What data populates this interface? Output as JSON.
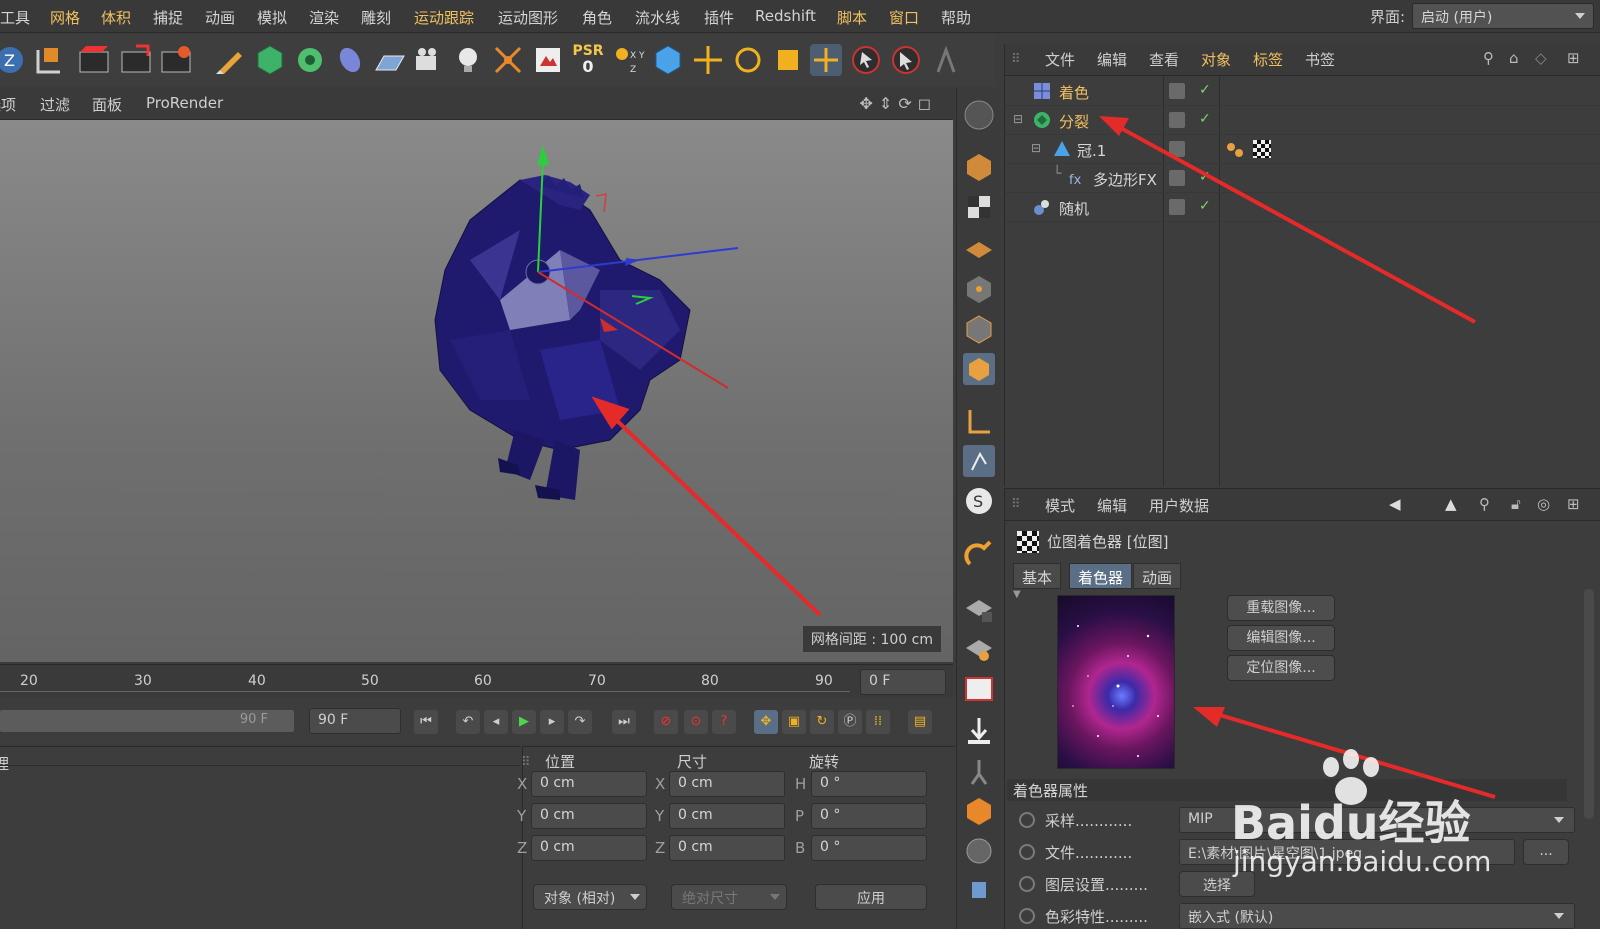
{
  "menubar": {
    "items": [
      "工具",
      "网格",
      "体积",
      "捕捉",
      "动画",
      "模拟",
      "渲染",
      "雕刻",
      "运动跟踪",
      "运动图形",
      "角色",
      "流水线",
      "插件",
      "Redshift",
      "脚本",
      "窗口",
      "帮助"
    ],
    "interface_label": "界面:",
    "interface_value": "启动 (用户)"
  },
  "toolbar": {
    "psr_label": "PSR",
    "psr_value": "0"
  },
  "viewport_menu": {
    "items": [
      "选项",
      "过滤",
      "面板",
      "ProRender"
    ]
  },
  "viewport": {
    "grid_spacing": "网格间距 : 100 cm"
  },
  "object_manager": {
    "menu": [
      "文件",
      "编辑",
      "查看",
      "对象",
      "标签",
      "书签"
    ],
    "rows": [
      {
        "name": "着色"
      },
      {
        "name": "分裂"
      },
      {
        "name": "冠.1"
      },
      {
        "name": "多边形FX"
      },
      {
        "name": "随机"
      }
    ]
  },
  "attribute_manager": {
    "menu": [
      "模式",
      "编辑",
      "用户数据"
    ],
    "title": "位图着色器 [位图]",
    "tabs": [
      "基本",
      "着色器",
      "动画"
    ],
    "active_tab": "着色器",
    "buttons": [
      "重载图像...",
      "编辑图像...",
      "定位图像..."
    ],
    "section": "着色器属性",
    "props": [
      {
        "label": "采样............",
        "value": "MIP"
      },
      {
        "label": "文件............",
        "value": "E:\\素材\\图片\\星空图\\1.jpeg"
      },
      {
        "label": "图层设置.........",
        "value": "选择"
      },
      {
        "label": "色彩特性.........",
        "value": "嵌入式 (默认)"
      }
    ],
    "more_button": "..."
  },
  "timeline": {
    "ticks": [
      "20",
      "30",
      "40",
      "50",
      "60",
      "70",
      "80",
      "90"
    ],
    "current": "0 F",
    "range_end_label": "90 F",
    "end_field": "90 F"
  },
  "coords": {
    "headers": [
      "位置",
      "尺寸",
      "旋转"
    ],
    "pos": [
      {
        "axis": "X",
        "value": "0 cm"
      },
      {
        "axis": "Y",
        "value": "0 cm"
      },
      {
        "axis": "Z",
        "value": "0 cm"
      }
    ],
    "size": [
      {
        "axis": "X",
        "value": "0 cm"
      },
      {
        "axis": "Y",
        "value": "0 cm"
      },
      {
        "axis": "Z",
        "value": "0 cm"
      }
    ],
    "rot": [
      {
        "axis": "H",
        "value": "0 °"
      },
      {
        "axis": "P",
        "value": "0 °"
      },
      {
        "axis": "B",
        "value": "0 °"
      }
    ],
    "mode_select": "对象 (相对)",
    "size_select": "绝对尺寸",
    "apply": "应用"
  },
  "left_panel": {
    "label": "理"
  },
  "watermark": {
    "brand": "Baidu经验",
    "url": "jingyan.baidu.com"
  },
  "colors": {
    "accent": "#f0c060",
    "active_tab": "#5a6f86",
    "annotation": "#e52a2a",
    "object": "#1f1a6e"
  }
}
